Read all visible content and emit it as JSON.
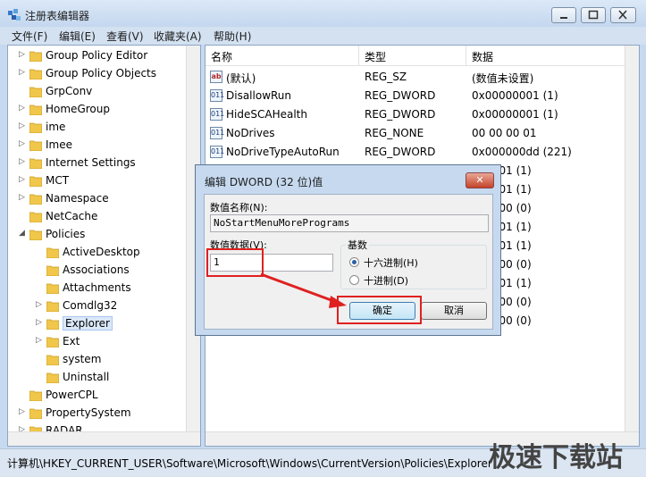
{
  "window": {
    "title": "注册表编辑器"
  },
  "menu": [
    "文件(F)",
    "编辑(E)",
    "查看(V)",
    "收藏夹(A)",
    "帮助(H)"
  ],
  "tree": [
    {
      "label": "Group Policy Editor",
      "arrow": "▷",
      "level": 0
    },
    {
      "label": "Group Policy Objects",
      "arrow": "▷",
      "level": 0
    },
    {
      "label": "GrpConv",
      "arrow": "",
      "level": 0
    },
    {
      "label": "HomeGroup",
      "arrow": "▷",
      "level": 0
    },
    {
      "label": "ime",
      "arrow": "▷",
      "level": 0
    },
    {
      "label": "Imee",
      "arrow": "▷",
      "level": 0
    },
    {
      "label": "Internet Settings",
      "arrow": "▷",
      "level": 0
    },
    {
      "label": "MCT",
      "arrow": "▷",
      "level": 0
    },
    {
      "label": "Namespace",
      "arrow": "▷",
      "level": 0
    },
    {
      "label": "NetCache",
      "arrow": "",
      "level": 0
    },
    {
      "label": "Policies",
      "arrow": "◢",
      "level": 0
    },
    {
      "label": "ActiveDesktop",
      "arrow": "",
      "level": 1
    },
    {
      "label": "Associations",
      "arrow": "",
      "level": 1
    },
    {
      "label": "Attachments",
      "arrow": "",
      "level": 1
    },
    {
      "label": "Comdlg32",
      "arrow": "▷",
      "level": 1
    },
    {
      "label": "Explorer",
      "arrow": "▷",
      "level": 1,
      "selected": true
    },
    {
      "label": "Ext",
      "arrow": "▷",
      "level": 1
    },
    {
      "label": "system",
      "arrow": "",
      "level": 1
    },
    {
      "label": "Uninstall",
      "arrow": "",
      "level": 1
    },
    {
      "label": "PowerCPL",
      "arrow": "",
      "level": 0
    },
    {
      "label": "PropertySystem",
      "arrow": "▷",
      "level": 0
    },
    {
      "label": "RADAR",
      "arrow": "▷",
      "level": 0
    }
  ],
  "list": {
    "headers": [
      "名称",
      "类型",
      "数据"
    ],
    "rows": [
      {
        "icon": "ab",
        "name": "(默认)",
        "type": "REG_SZ",
        "data": "(数值未设置)"
      },
      {
        "icon": "011",
        "name": "DisallowRun",
        "type": "REG_DWORD",
        "data": "0x00000001 (1)"
      },
      {
        "icon": "011",
        "name": "HideSCAHealth",
        "type": "REG_DWORD",
        "data": "0x00000001 (1)"
      },
      {
        "icon": "011",
        "name": "NoDrives",
        "type": "REG_NONE",
        "data": "00 00 00 01"
      },
      {
        "icon": "011",
        "name": "NoDriveTypeAutoRun",
        "type": "REG_DWORD",
        "data": "0x000000dd (221)"
      },
      {
        "icon": "",
        "name": "",
        "type": "",
        "data": "000001 (1)"
      },
      {
        "icon": "",
        "name": "",
        "type": "",
        "data": "000001 (1)"
      },
      {
        "icon": "",
        "name": "",
        "type": "",
        "data": "000000 (0)"
      },
      {
        "icon": "",
        "name": "",
        "type": "",
        "data": "000001 (1)"
      },
      {
        "icon": "",
        "name": "",
        "type": "",
        "data": "000001 (1)"
      },
      {
        "icon": "",
        "name": "",
        "type": "",
        "data": "000000 (0)"
      },
      {
        "icon": "",
        "name": "",
        "type": "",
        "data": "000001 (1)"
      },
      {
        "icon": "",
        "name": "",
        "type": "",
        "data": "000000 (0)"
      },
      {
        "icon": "",
        "name": "",
        "type": "",
        "data": "000000 (0)"
      }
    ]
  },
  "status": "计算机\\HKEY_CURRENT_USER\\Software\\Microsoft\\Windows\\CurrentVersion\\Policies\\Explorer",
  "watermark": "极速下载站",
  "dialog": {
    "title": "编辑 DWORD (32 位)值",
    "close_glyph": "✕",
    "name_label": "数值名称(N):",
    "name_value": "NoStartMenuMorePrograms",
    "data_label": "数值数据(V):",
    "data_value": "1",
    "base_label": "基数",
    "hex_label": "十六进制(H)",
    "dec_label": "十进制(D)",
    "ok_label": "确定",
    "cancel_label": "取消",
    "hex_selected": true
  },
  "colors": {
    "highlight": "#e02020",
    "window_frame": "#c6d9ef"
  }
}
